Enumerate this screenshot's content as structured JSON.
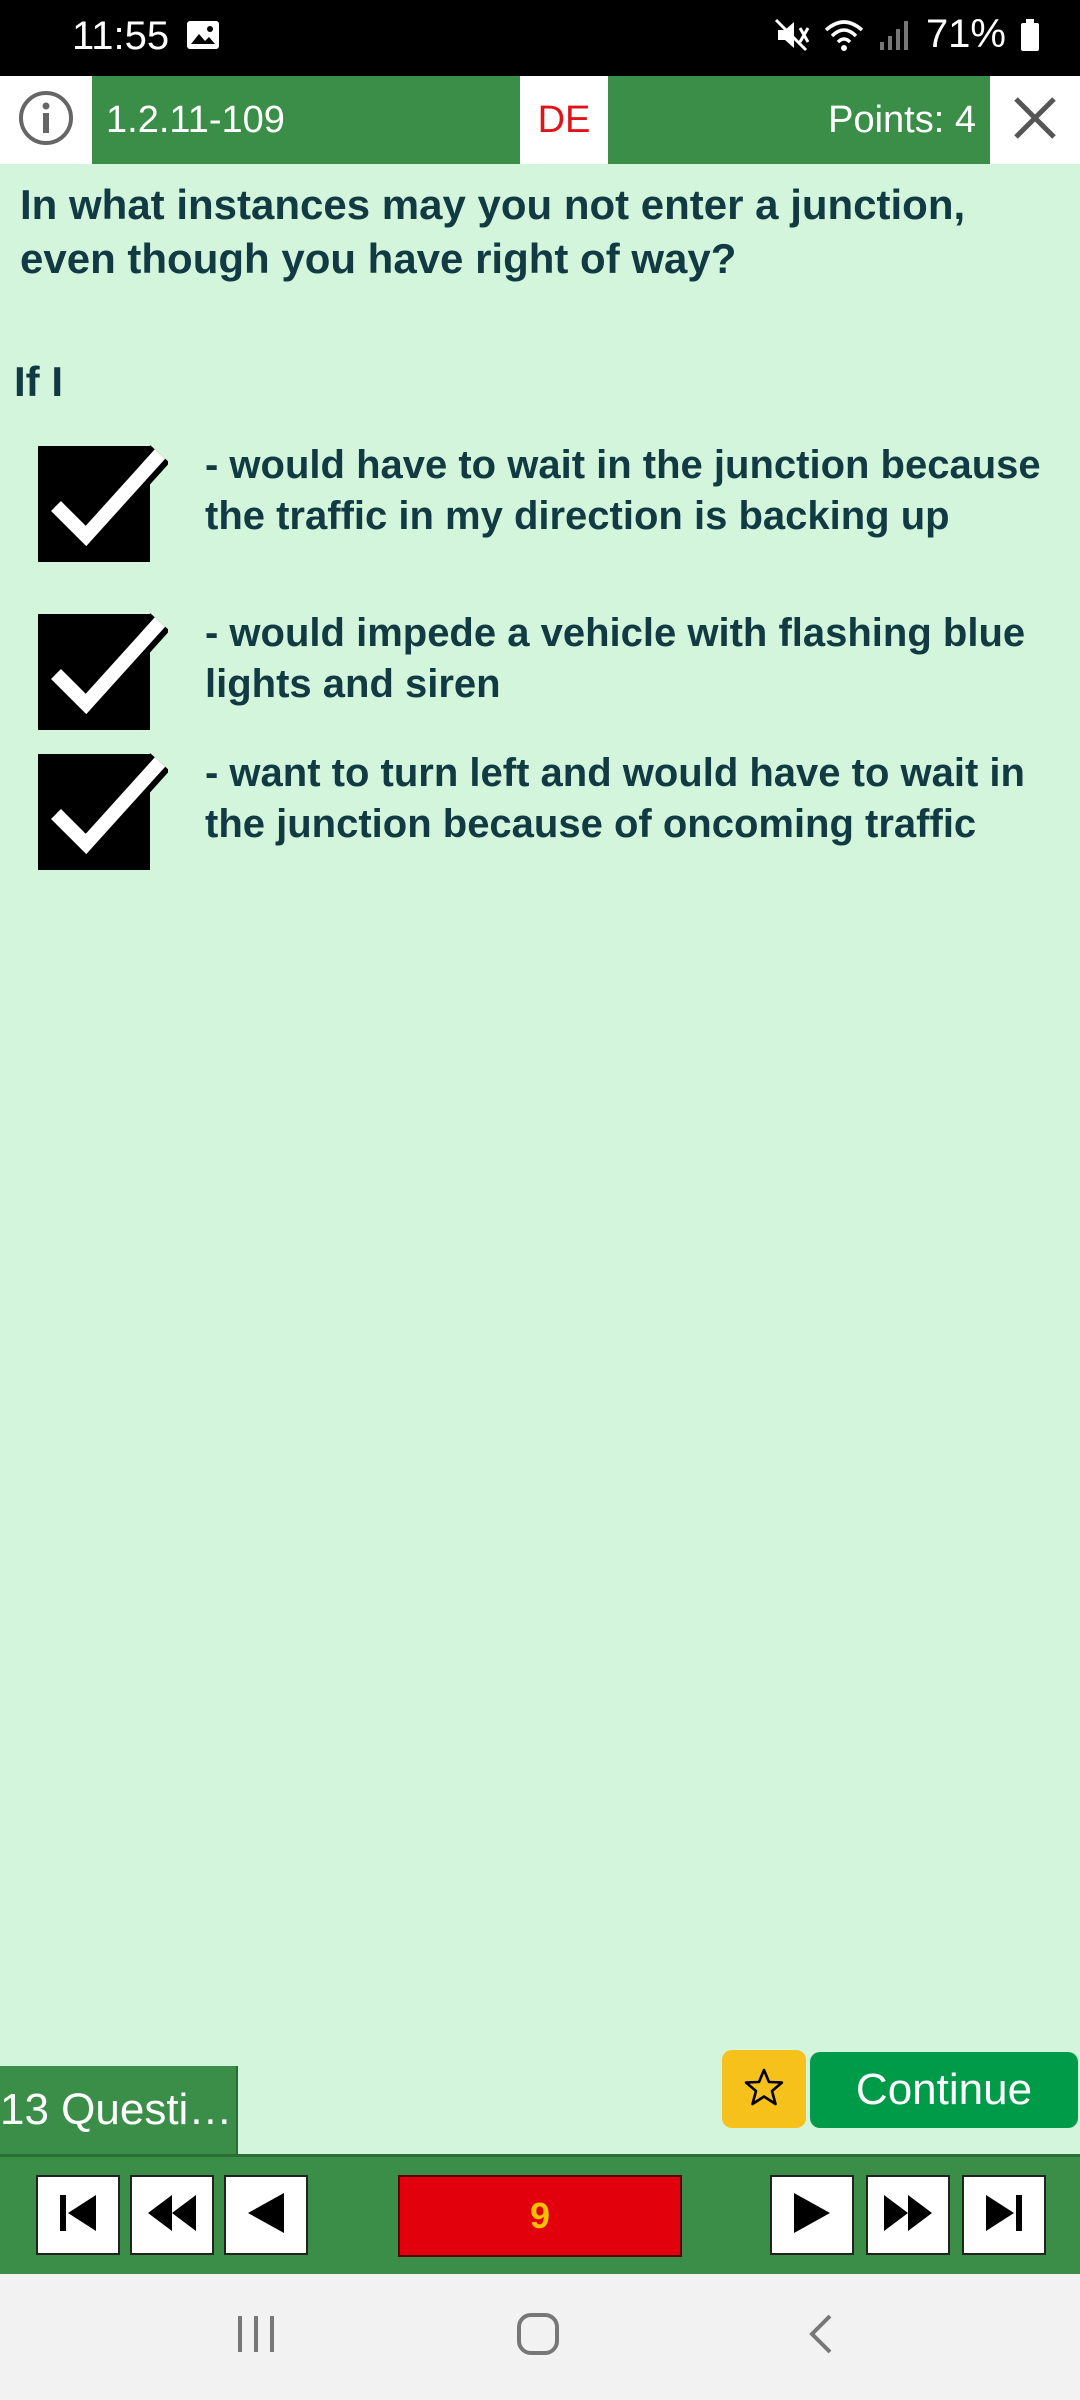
{
  "status_bar": {
    "time": "11:55",
    "battery": "71%",
    "icons": [
      "gallery-icon",
      "mute-icon",
      "wifi-icon",
      "signal-icon",
      "battery-icon"
    ]
  },
  "header": {
    "question_id": "1.2.11-109",
    "language": "DE",
    "points": "Points: 4",
    "info_icon": "info-icon",
    "close_icon": "close-icon"
  },
  "question": {
    "text": "In what instances may you not enter a junction, even though you have right of way?",
    "intro": "If I",
    "answers": [
      {
        "text": "- would have to wait in the junction because the traffic in my direction is backing up",
        "checked": true
      },
      {
        "text": "- would impede a vehicle with flashing blue lights and siren",
        "checked": true
      },
      {
        "text": "- want to turn left and would have to wait in the junction because of oncoming traffic",
        "checked": true
      }
    ]
  },
  "actions": {
    "questions_tab": "13 Questi…",
    "continue_label": "Continue",
    "star_icon": "star-icon"
  },
  "navigation": {
    "current_page": "9",
    "buttons": [
      "first-icon",
      "rewind-icon",
      "previous-icon",
      "next-icon",
      "fast-forward-icon",
      "last-icon"
    ]
  },
  "colors": {
    "header_green": "#3a8e48",
    "background": "#d2f5db",
    "continue_green": "#009b49",
    "star_yellow": "#f6c11b",
    "page_red": "#e2000c",
    "lang_red": "#e0131a",
    "text_dark": "#113a43"
  }
}
